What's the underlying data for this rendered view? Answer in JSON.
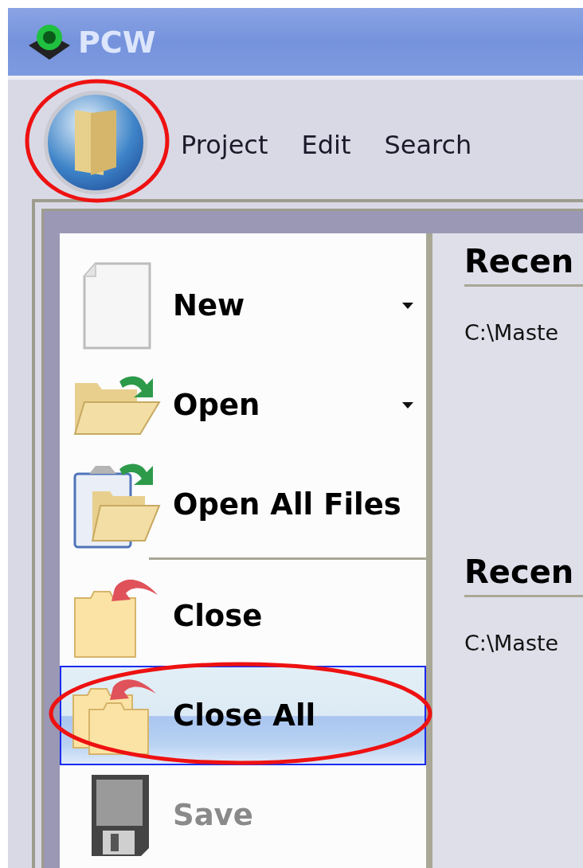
{
  "window": {
    "title": "PCW"
  },
  "menubar": [
    "Project",
    "Edit",
    "Search"
  ],
  "app_menu": {
    "items": [
      {
        "kind": "item",
        "label": "New",
        "has_submenu": true,
        "selected": false,
        "disabled": false
      },
      {
        "kind": "item",
        "label": "Open",
        "has_submenu": true,
        "selected": false,
        "disabled": false
      },
      {
        "kind": "item",
        "label": "Open All Files",
        "has_submenu": false,
        "selected": false,
        "disabled": false
      },
      {
        "kind": "separator"
      },
      {
        "kind": "item",
        "label": "Close",
        "has_submenu": false,
        "selected": false,
        "disabled": false
      },
      {
        "kind": "item",
        "label": "Close All",
        "has_submenu": false,
        "selected": true,
        "disabled": false
      },
      {
        "kind": "item",
        "label": "Save",
        "has_submenu": false,
        "selected": false,
        "disabled": true
      }
    ]
  },
  "recent_sections": [
    {
      "heading": "Recen",
      "entries": [
        "C:\\Maste"
      ]
    },
    {
      "heading": "Recen",
      "entries": [
        "C:\\Maste"
      ]
    }
  ]
}
